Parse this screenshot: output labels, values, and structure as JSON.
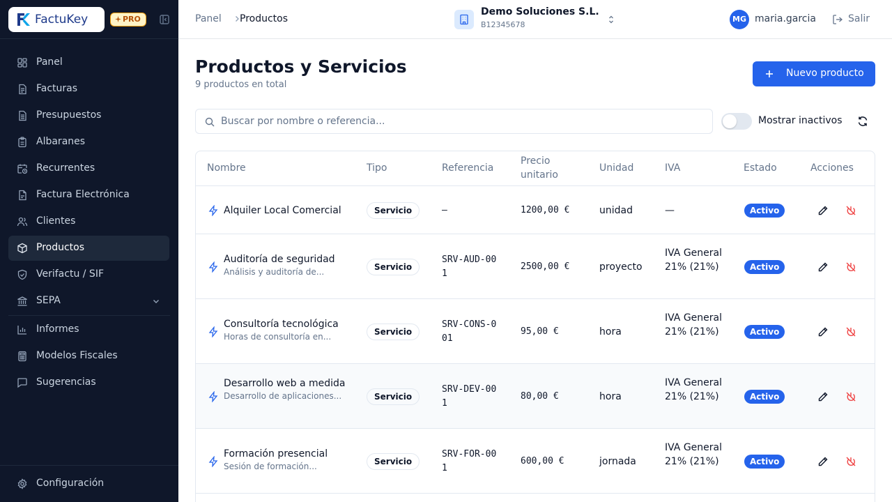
{
  "brand": {
    "name_a": "Factu",
    "name_b": "Key",
    "plan": "PRO"
  },
  "sidebar": {
    "items": [
      {
        "label": "Panel",
        "icon": "dashboard-icon"
      },
      {
        "label": "Facturas",
        "icon": "invoice-icon"
      },
      {
        "label": "Presupuestos",
        "icon": "quote-icon"
      },
      {
        "label": "Albaranes",
        "icon": "clipboard-icon"
      },
      {
        "label": "Recurrentes",
        "icon": "calendar-clock-icon"
      },
      {
        "label": "Factura Electrónica",
        "icon": "e-invoice-icon"
      },
      {
        "label": "Clientes",
        "icon": "users-icon"
      },
      {
        "label": "Productos",
        "icon": "package-icon"
      },
      {
        "label": "Verifactu / SIF",
        "icon": "shield-check-icon"
      },
      {
        "label": "SEPA",
        "icon": "bank-icon"
      },
      {
        "label": "Informes",
        "icon": "bar-chart-icon"
      },
      {
        "label": "Modelos Fiscales",
        "icon": "calculator-icon"
      },
      {
        "label": "Sugerencias",
        "icon": "message-icon"
      }
    ],
    "settings": {
      "label": "Configuración",
      "icon": "gear-icon"
    }
  },
  "header": {
    "breadcrumb": [
      "Panel",
      "Productos"
    ],
    "company": {
      "name": "Demo Soluciones S.L.",
      "nif": "B12345678"
    },
    "user": {
      "initials": "MG",
      "name": "maria.garcia"
    },
    "logout_label": "Salir"
  },
  "page": {
    "title": "Productos y Servicios",
    "subtitle": "9 productos en total",
    "new_button": "Nuevo producto",
    "search_placeholder": "Buscar por nombre o referencia...",
    "search_value": "",
    "toggle_label": "Mostrar inactivos",
    "show_inactive": false
  },
  "table": {
    "columns": [
      "Nombre",
      "Tipo",
      "Referencia",
      "Precio unitario",
      "Unidad",
      "IVA",
      "Estado",
      "Acciones"
    ],
    "rows": [
      {
        "name": "Alquiler Local Comercial",
        "desc": "",
        "type": "Servicio",
        "ref": "—",
        "price": "1200,00 €",
        "unit": "unidad",
        "iva": "—",
        "status": "Activo"
      },
      {
        "name": "Auditoría de seguridad",
        "desc": "Análisis y auditoría de...",
        "type": "Servicio",
        "ref": "SRV-AUD-001",
        "price": "2500,00 €",
        "unit": "proyecto",
        "iva": "IVA General 21% (21%)",
        "status": "Activo"
      },
      {
        "name": "Consultoría tecnológica",
        "desc": "Horas de consultoría en...",
        "type": "Servicio",
        "ref": "SRV-CONS-001",
        "price": "95,00 €",
        "unit": "hora",
        "iva": "IVA General 21% (21%)",
        "status": "Activo"
      },
      {
        "name": "Desarrollo web a medida",
        "desc": "Desarrollo de aplicaciones...",
        "type": "Servicio",
        "ref": "SRV-DEV-001",
        "price": "80,00 €",
        "unit": "hora",
        "iva": "IVA General 21% (21%)",
        "status": "Activo"
      },
      {
        "name": "Formación presencial",
        "desc": "Sesión de formación...",
        "type": "Servicio",
        "ref": "SRV-FOR-001",
        "price": "600,00 €",
        "unit": "jornada",
        "iva": "IVA General 21% (21%)",
        "status": "Activo"
      }
    ]
  },
  "colors": {
    "primary": "#2563eb",
    "sidebar_bg": "#0f172a",
    "danger": "#ef4444",
    "badge_pro": "#f59e0b"
  }
}
